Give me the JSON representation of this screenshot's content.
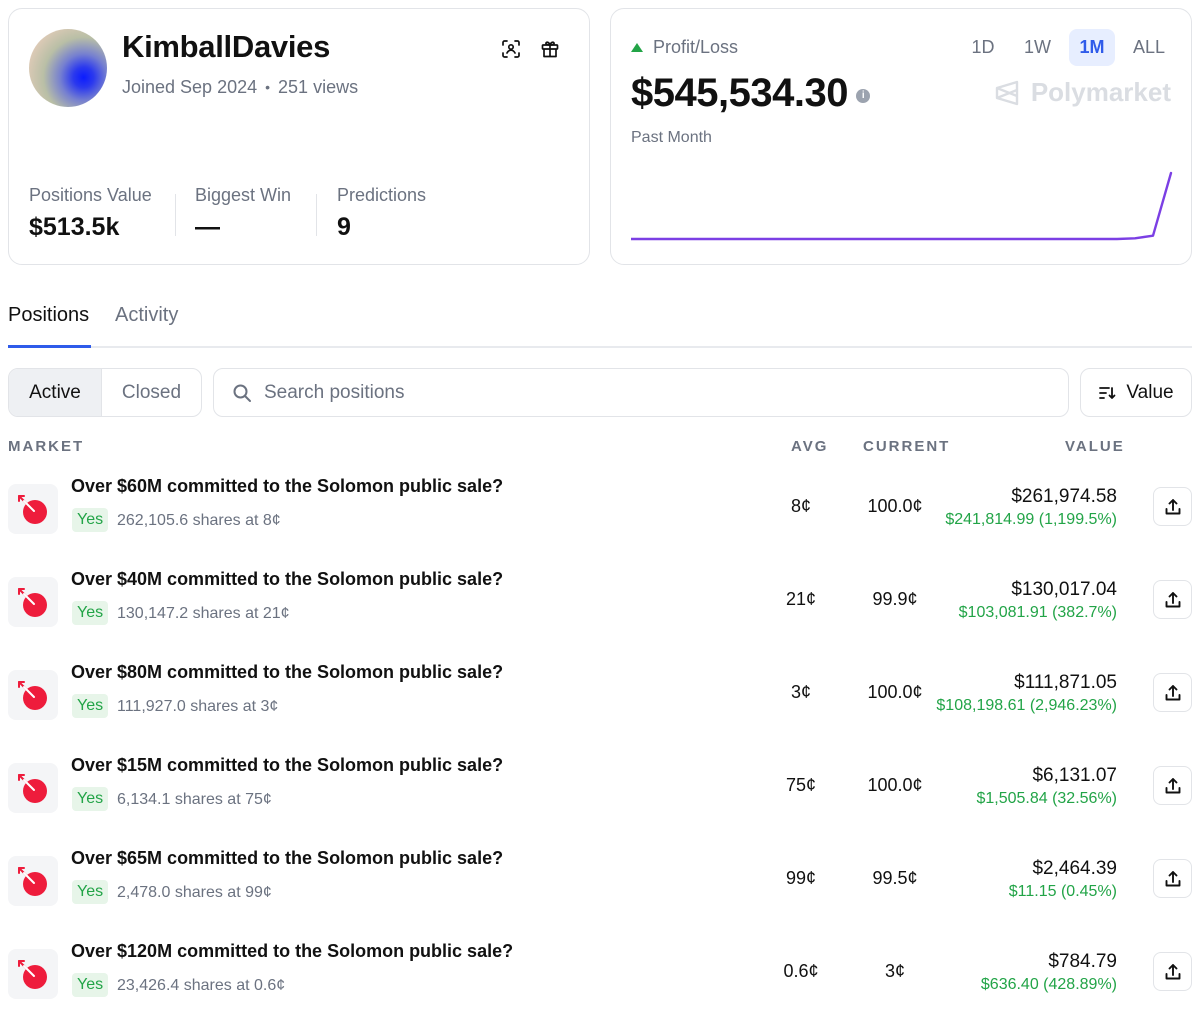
{
  "profile": {
    "username": "KimballDavies",
    "joined": "Joined Sep 2024",
    "views": "251 views",
    "stats": [
      {
        "label": "Positions Value",
        "value": "$513.5k"
      },
      {
        "label": "Biggest Win",
        "value": "—"
      },
      {
        "label": "Predictions",
        "value": "9"
      }
    ],
    "icons": [
      "scan-icon",
      "gift-icon"
    ]
  },
  "pnl": {
    "label": "Profit/Loss",
    "value": "$545,534.30",
    "period": "Past Month",
    "ranges": [
      "1D",
      "1W",
      "1M",
      "ALL"
    ],
    "selected_range": "1M",
    "watermark": "Polymarket",
    "trend_color": "#7b3fe4",
    "sparkline": [
      0,
      0,
      0,
      0,
      0,
      0,
      0,
      0,
      0,
      0,
      0,
      0,
      0,
      0,
      0,
      0,
      0,
      0,
      0,
      0,
      0,
      0,
      0,
      0,
      0,
      0,
      0,
      0,
      0.01,
      0.05,
      1.0
    ]
  },
  "tabs": [
    "Positions",
    "Activity"
  ],
  "filter": {
    "active": "Active",
    "closed": "Closed"
  },
  "search": {
    "placeholder": "Search positions"
  },
  "sort": {
    "label": "Value"
  },
  "columns": {
    "market": "MARKET",
    "avg": "AVG",
    "current": "CURRENT",
    "value": "VALUE"
  },
  "positions": [
    {
      "title": "Over $60M committed to the Solomon public sale?",
      "outcome": "Yes",
      "shares": "262,105.6 shares at 8¢",
      "avg": "8¢",
      "current": "100.0¢",
      "value": "$261,974.58",
      "pnl": "$241,814.99 (1,199.5%)"
    },
    {
      "title": "Over $40M committed to the Solomon public sale?",
      "outcome": "Yes",
      "shares": "130,147.2 shares at 21¢",
      "avg": "21¢",
      "current": "99.9¢",
      "value": "$130,017.04",
      "pnl": "$103,081.91 (382.7%)"
    },
    {
      "title": "Over $80M committed to the Solomon public sale?",
      "outcome": "Yes",
      "shares": "111,927.0 shares at 3¢",
      "avg": "3¢",
      "current": "100.0¢",
      "value": "$111,871.05",
      "pnl": "$108,198.61 (2,946.23%)"
    },
    {
      "title": "Over $15M committed to the Solomon public sale?",
      "outcome": "Yes",
      "shares": "6,134.1 shares at 75¢",
      "avg": "75¢",
      "current": "100.0¢",
      "value": "$6,131.07",
      "pnl": "$1,505.84 (32.56%)"
    },
    {
      "title": "Over $65M committed to the Solomon public sale?",
      "outcome": "Yes",
      "shares": "2,478.0 shares at 99¢",
      "avg": "99¢",
      "current": "99.5¢",
      "value": "$2,464.39",
      "pnl": "$11.15 (0.45%)"
    },
    {
      "title": "Over $120M committed to the Solomon public sale?",
      "outcome": "Yes",
      "shares": "23,426.4 shares at 0.6¢",
      "avg": "0.6¢",
      "current": "3¢",
      "value": "$784.79",
      "pnl": "$636.40 (428.89%)"
    }
  ]
}
